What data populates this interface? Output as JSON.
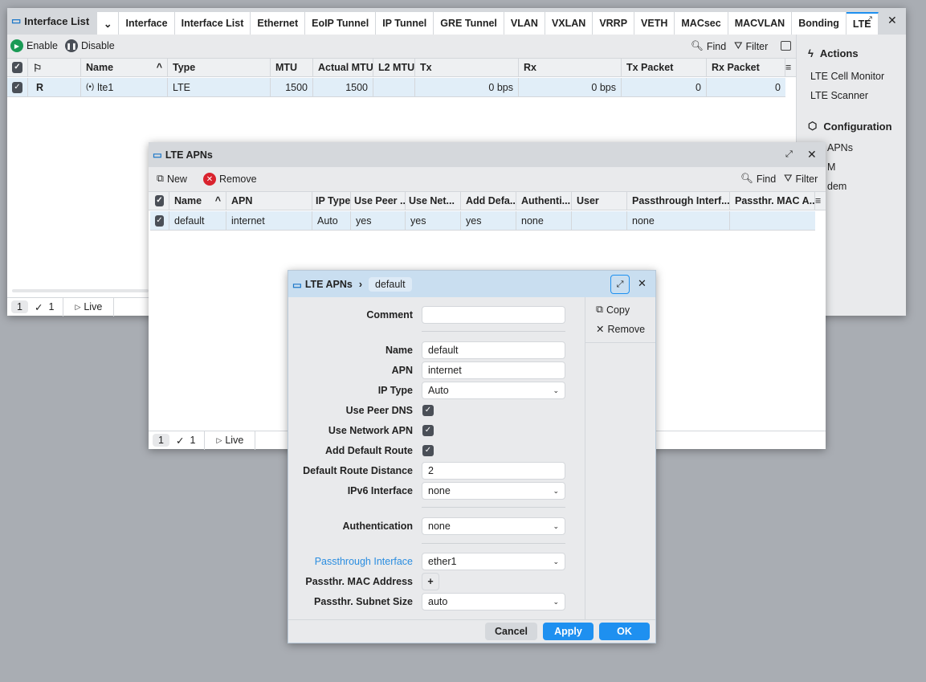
{
  "window1": {
    "title": "Interface List",
    "tabs": [
      "Interface",
      "Interface List",
      "Ethernet",
      "EoIP Tunnel",
      "IP Tunnel",
      "GRE Tunnel",
      "VLAN",
      "VXLAN",
      "VRRP",
      "VETH",
      "MACsec",
      "MACVLAN",
      "Bonding",
      "LTE"
    ],
    "active_tab": "LTE",
    "toolbar": {
      "enable": "Enable",
      "disable": "Disable",
      "find": "Find",
      "filter": "Filter"
    },
    "columns": [
      "Name",
      "Type",
      "MTU",
      "Actual MTU",
      "L2 MTU",
      "Tx",
      "Rx",
      "Tx Packet",
      "Rx Packet"
    ],
    "rows": [
      {
        "flag": "R",
        "name": "lte1",
        "type": "LTE",
        "mtu": "1500",
        "actual_mtu": "1500",
        "l2mtu": "",
        "tx": "0 bps",
        "rx": "0 bps",
        "tx_packet": "0",
        "rx_packet": "0"
      }
    ],
    "footer": {
      "count": "1",
      "selected": "1",
      "live": "Live"
    },
    "side": {
      "actions_title": "Actions",
      "actions": [
        "LTE Cell Monitor",
        "LTE Scanner"
      ],
      "config_title": "Configuration",
      "config": [
        "APNs",
        "M",
        "dem"
      ]
    }
  },
  "window2": {
    "title": "LTE APNs",
    "toolbar": {
      "new": "New",
      "remove": "Remove",
      "find": "Find",
      "filter": "Filter"
    },
    "columns": [
      "Name",
      "APN",
      "IP Type",
      "Use Peer ...",
      "Use Net...",
      "Add Defa...",
      "Authenti...",
      "User",
      "Passthrough Interf...",
      "Passthr. MAC A..."
    ],
    "rows": [
      [
        "default",
        "internet",
        "Auto",
        "yes",
        "yes",
        "yes",
        "none",
        "",
        "none",
        ""
      ]
    ],
    "footer": {
      "count": "1",
      "selected": "1",
      "live": "Live"
    }
  },
  "dialog": {
    "breadcrumb_parent": "LTE APNs",
    "breadcrumb_current": "default",
    "copy": "Copy",
    "remove": "Remove",
    "fields": {
      "comment": {
        "label": "Comment",
        "value": ""
      },
      "name": {
        "label": "Name",
        "value": "default"
      },
      "apn": {
        "label": "APN",
        "value": "internet"
      },
      "ip_type": {
        "label": "IP Type",
        "value": "Auto"
      },
      "use_peer_dns": {
        "label": "Use Peer DNS",
        "checked": true
      },
      "use_network_apn": {
        "label": "Use Network APN",
        "checked": true
      },
      "add_default_route": {
        "label": "Add Default Route",
        "checked": true
      },
      "default_route_distance": {
        "label": "Default Route Distance",
        "value": "2"
      },
      "ipv6_interface": {
        "label": "IPv6 Interface",
        "value": "none"
      },
      "authentication": {
        "label": "Authentication",
        "value": "none"
      },
      "passthrough_interface": {
        "label": "Passthrough Interface",
        "value": "ether1"
      },
      "passthr_mac": {
        "label": "Passthr. MAC Address"
      },
      "passthr_subnet": {
        "label": "Passthr. Subnet Size",
        "value": "auto"
      }
    },
    "buttons": {
      "cancel": "Cancel",
      "apply": "Apply",
      "ok": "OK"
    }
  },
  "colors": {
    "accent": "#1e90f0",
    "active_label": "#2a8de0",
    "dialog_title": "#c9def0",
    "row_selected": "#e1eef8"
  }
}
